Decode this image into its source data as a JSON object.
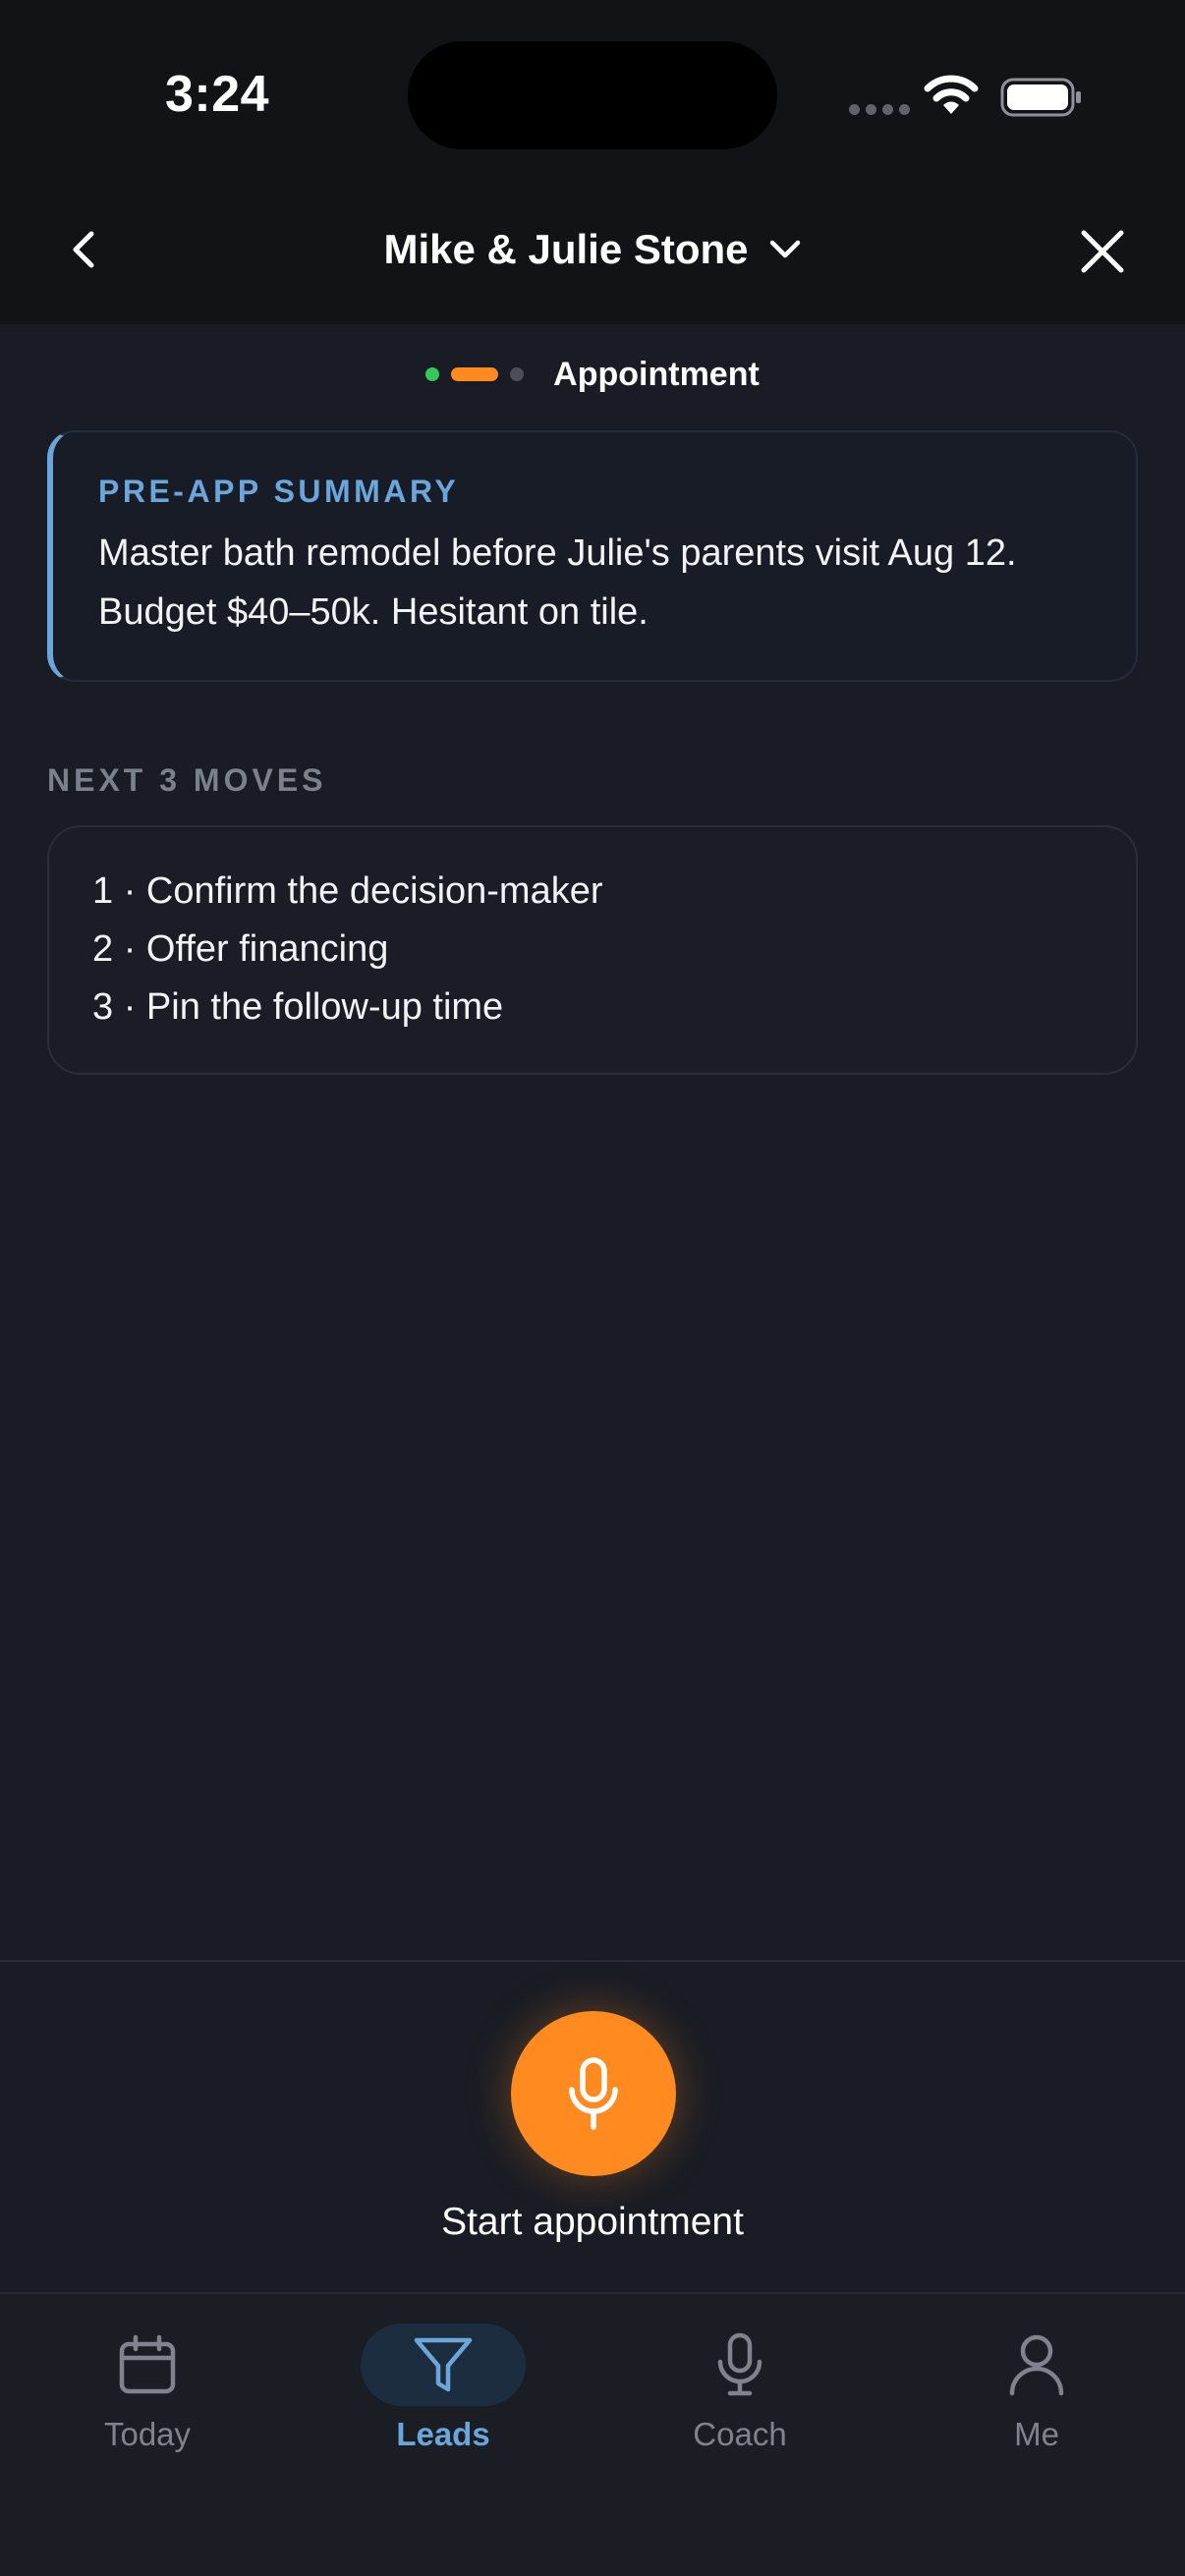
{
  "status_bar": {
    "time": "3:24"
  },
  "header": {
    "title": "Mike & Julie Stone"
  },
  "steps": {
    "label": "Appointment"
  },
  "summary": {
    "title": "PRE-APP SUMMARY",
    "line1": "Master bath remodel before Julie's parents visit Aug 12.",
    "line2": "Budget $40–50k. Hesitant on tile."
  },
  "moves": {
    "heading": "NEXT 3 MOVES",
    "items": [
      "1 · Confirm the decision-maker",
      "2 · Offer financing",
      "3 · Pin the follow-up time"
    ]
  },
  "action": {
    "label": "Start appointment"
  },
  "tabs": [
    {
      "label": "Today",
      "icon": "calendar-icon"
    },
    {
      "label": "Leads",
      "icon": "filter-icon",
      "active": true
    },
    {
      "label": "Coach",
      "icon": "microphone-icon"
    },
    {
      "label": "Me",
      "icon": "person-icon"
    }
  ],
  "colors": {
    "accent": "#ff8a1f",
    "link": "#6aa6da",
    "background": "#191c24",
    "step_done": "#34c759"
  }
}
